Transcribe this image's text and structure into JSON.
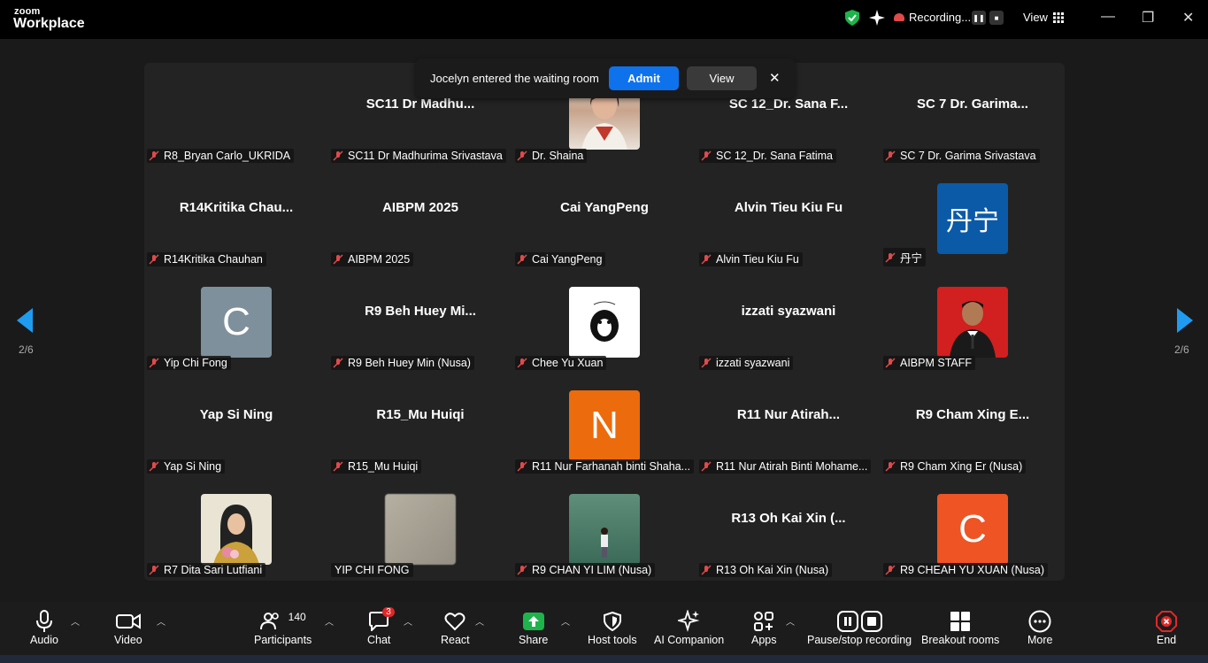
{
  "app": {
    "logo_small": "zoom",
    "logo_big": "Workplace"
  },
  "topbar": {
    "recording": "Recording...",
    "view": "View"
  },
  "notification": {
    "text": "Jocelyn entered the waiting room",
    "admit": "Admit",
    "view": "View",
    "close": "✕"
  },
  "pager": {
    "left": "2/6",
    "right": "2/6"
  },
  "tiles": [
    {
      "big": "",
      "label": "R8_Bryan Carlo_UKRIDA"
    },
    {
      "big": "SC11  Dr  Madhu...",
      "label": "SC11 Dr Madhurima Srivastava"
    },
    {
      "big": "",
      "label": "Dr. Shaina"
    },
    {
      "big": "SC 12_Dr. Sana F...",
      "label": "SC 12_Dr. Sana Fatima"
    },
    {
      "big": "SC 7 Dr. Garima...",
      "label": "SC 7 Dr. Garima Srivastava"
    },
    {
      "big": "R14Kritika  Chau...",
      "label": "R14Kritika Chauhan"
    },
    {
      "big": "AIBPM 2025",
      "label": "AIBPM 2025"
    },
    {
      "big": "Cai YangPeng",
      "label": "Cai YangPeng"
    },
    {
      "big": "Alvin Tieu Kiu Fu",
      "label": "Alvin Tieu Kiu Fu"
    },
    {
      "big": "",
      "label": "丹宁",
      "avatar_text": "丹宁"
    },
    {
      "big": "",
      "label": "Yip Chi Fong",
      "avatar_text": "C"
    },
    {
      "big": "R9  Beh  Huey  Mi...",
      "label": "R9 Beh Huey Min (Nusa)"
    },
    {
      "big": "",
      "label": "Chee Yu Xuan"
    },
    {
      "big": "izzati syazwani",
      "label": "izzati syazwani"
    },
    {
      "big": "",
      "label": "AIBPM STAFF"
    },
    {
      "big": "Yap Si Ning",
      "label": "Yap Si Ning"
    },
    {
      "big": "R15_Mu Huiqi",
      "label": "R15_Mu Huiqi"
    },
    {
      "big": "",
      "label": "R11 Nur Farhanah binti Shaha...",
      "avatar_text": "N"
    },
    {
      "big": "R11 Nur Atirah...",
      "label": "R11 Nur Atirah Binti Mohame..."
    },
    {
      "big": "R9 Cham Xing E...",
      "label": "R9 Cham Xing Er (Nusa)"
    },
    {
      "big": "",
      "label": "R7 Dita Sari Lutfiani"
    },
    {
      "big": "",
      "label": "YIP CHI FONG"
    },
    {
      "big": "",
      "label": "R9 CHAN YI LIM (Nusa)"
    },
    {
      "big": "R13 Oh Kai Xin (...",
      "label": "R13 Oh Kai Xin (Nusa)"
    },
    {
      "big": "",
      "label": "R9 CHEAH YU XUAN (Nusa)",
      "avatar_text": "C"
    }
  ],
  "toolbar": {
    "audio": "Audio",
    "video": "Video",
    "participants": "Participants",
    "participant_count": "140",
    "chat": "Chat",
    "chat_badge": "3",
    "react": "React",
    "share": "Share",
    "host_tools": "Host tools",
    "ai_companion": "AI Companion",
    "apps": "Apps",
    "pause_recording": "Pause/stop recording",
    "breakout": "Breakout rooms",
    "more": "More",
    "end": "End"
  },
  "colors": {
    "accent_blue": "#0e72ed",
    "share_green": "#1fb34b",
    "end_red": "#e02828",
    "mute_red": "#e04a4a"
  }
}
